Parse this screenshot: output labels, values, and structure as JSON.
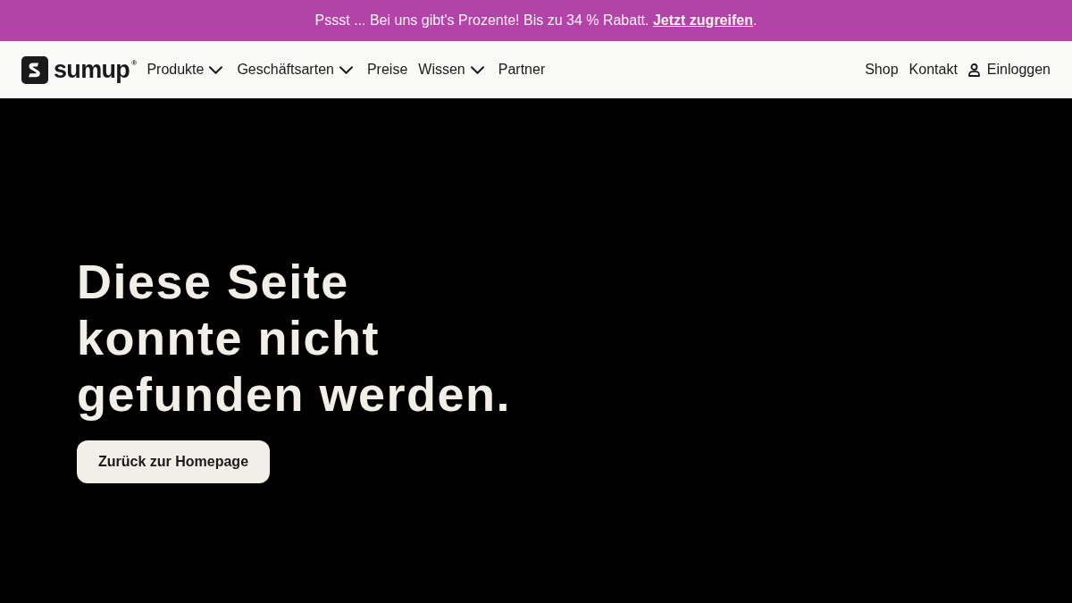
{
  "promo_banner": {
    "text": "Pssst ... Bei uns gibt's Prozente! Bis zu 34 % Rabatt.",
    "link": "Jetzt zugreifen",
    "after_link": "."
  },
  "header": {
    "logo": {
      "text": "sumup",
      "mark": "®"
    },
    "nav": [
      {
        "label": "Produkte",
        "dropdown": true
      },
      {
        "label": "Geschäftsarten",
        "dropdown": true
      },
      {
        "label": "Preise",
        "dropdown": false
      },
      {
        "label": "Wissen",
        "dropdown": true
      },
      {
        "label": "Partner",
        "dropdown": false
      }
    ],
    "actions": [
      {
        "label": "Shop",
        "kind": "link"
      },
      {
        "label": "Kontakt",
        "kind": "link"
      },
      {
        "label": "Einloggen",
        "kind": "login"
      }
    ]
  },
  "hero": {
    "heading": "Diese Seite konnte nicht gefunden werden.",
    "button": "Zurück zur Homepage"
  }
}
